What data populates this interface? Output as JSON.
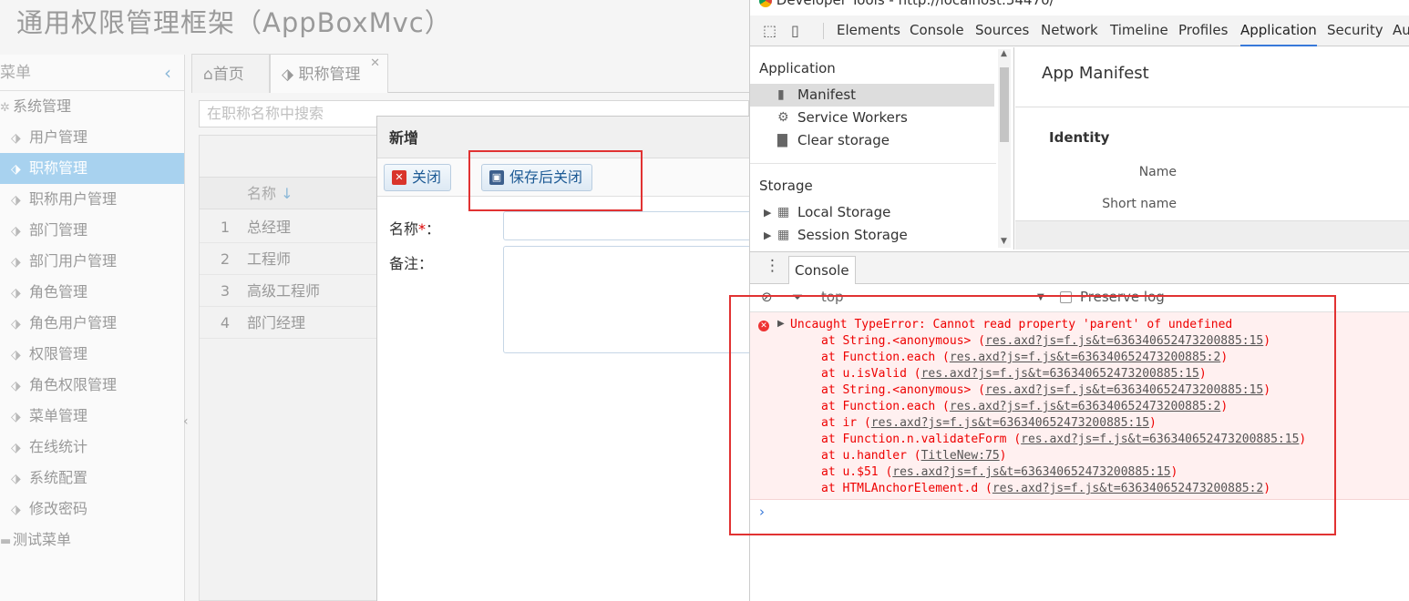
{
  "app": {
    "title": "通用权限管理框架（AppBoxMvc）",
    "sidebar": {
      "header": "菜单",
      "collapse_icon": "‹",
      "groups": [
        {
          "label": "系统管理"
        },
        {
          "label": "测试菜单"
        }
      ],
      "items": [
        {
          "label": "用户管理"
        },
        {
          "label": "职称管理",
          "active": true
        },
        {
          "label": "职称用户管理"
        },
        {
          "label": "部门管理"
        },
        {
          "label": "部门用户管理"
        },
        {
          "label": "角色管理"
        },
        {
          "label": "角色用户管理"
        },
        {
          "label": "权限管理"
        },
        {
          "label": "角色权限管理"
        },
        {
          "label": "菜单管理"
        },
        {
          "label": "在线统计"
        },
        {
          "label": "系统配置"
        },
        {
          "label": "修改密码"
        }
      ]
    },
    "tabs": [
      {
        "label": "首页"
      },
      {
        "label": "职称管理"
      }
    ],
    "search_placeholder": "在职称名称中搜索",
    "grid": {
      "column_name": "名称",
      "sort_icon": "↓",
      "rows": [
        {
          "index": "1",
          "name": "总经理"
        },
        {
          "index": "2",
          "name": "工程师"
        },
        {
          "index": "3",
          "name": "高级工程师"
        },
        {
          "index": "4",
          "name": "部门经理"
        }
      ]
    },
    "dialog": {
      "title": "新增",
      "close_label": "关闭",
      "save_close_label": "保存后关闭",
      "name_label": "名称",
      "required_mark": "*",
      "colon": "：",
      "remark_label": "备注："
    }
  },
  "devtools": {
    "titlebar": "Developer Tools - http://localhost:54470/",
    "tabs": [
      "Elements",
      "Console",
      "Sources",
      "Network",
      "Timeline",
      "Profiles",
      "Application",
      "Security",
      "Au"
    ],
    "active_tab": "Application",
    "nav": {
      "application_heading": "Application",
      "application_items": [
        "Manifest",
        "Service Workers",
        "Clear storage"
      ],
      "storage_heading": "Storage",
      "storage_items": [
        "Local Storage",
        "Session Storage"
      ]
    },
    "manifest": {
      "title": "App Manifest",
      "section": "Identity",
      "fields": [
        "Name",
        "Short name"
      ]
    },
    "drawer": {
      "tab": "Console",
      "context": "top",
      "preserve_log": "Preserve log"
    },
    "console": {
      "error_message": "Uncaught TypeError: Cannot read property 'parent' of undefined",
      "stack": [
        {
          "fn": "at String.<anonymous> (",
          "link": "res.axd?js=f.js&t=636340652473200885:15",
          "close": ")"
        },
        {
          "fn": "at Function.each (",
          "link": "res.axd?js=f.js&t=636340652473200885:2",
          "close": ")"
        },
        {
          "fn": "at u.isValid (",
          "link": "res.axd?js=f.js&t=636340652473200885:15",
          "close": ")"
        },
        {
          "fn": "at String.<anonymous> (",
          "link": "res.axd?js=f.js&t=636340652473200885:15",
          "close": ")"
        },
        {
          "fn": "at Function.each (",
          "link": "res.axd?js=f.js&t=636340652473200885:2",
          "close": ")"
        },
        {
          "fn": "at ir (",
          "link": "res.axd?js=f.js&t=636340652473200885:15",
          "close": ")"
        },
        {
          "fn": "at Function.n.validateForm (",
          "link": "res.axd?js=f.js&t=636340652473200885:15",
          "close": ")"
        },
        {
          "fn": "at u.handler (",
          "link": "TitleNew:75",
          "close": ")"
        },
        {
          "fn": "at u.$51 (",
          "link": "res.axd?js=f.js&t=636340652473200885:15",
          "close": ")"
        },
        {
          "fn": "at HTMLAnchorElement.d (",
          "link": "res.axd?js=f.js&t=636340652473200885:2",
          "close": ")"
        }
      ],
      "prompt": "›"
    }
  },
  "colors": {
    "annotation_red": "#e13232",
    "active_menu": "#a8d2ef",
    "devtools_accent": "#3879d9",
    "error_bg": "#fff0f0"
  }
}
